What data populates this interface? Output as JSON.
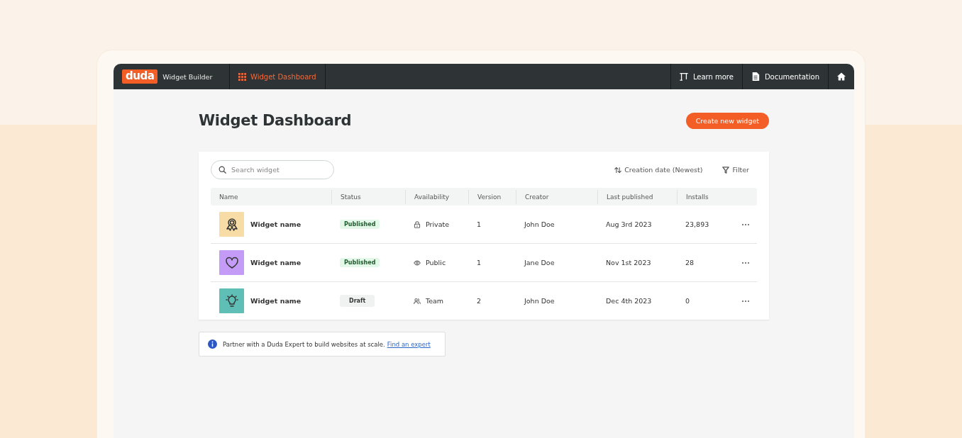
{
  "navbar": {
    "logo": "duda",
    "product": "Widget Builder",
    "tabs": [
      {
        "label": "Widget Dashboard",
        "selected": true
      }
    ],
    "links": [
      {
        "kind": "learn",
        "label": "Learn more"
      },
      {
        "kind": "docs",
        "label": "Documentation"
      },
      {
        "kind": "home"
      }
    ]
  },
  "page": {
    "title": "Widget Dashboard",
    "create_button": "Create new widget"
  },
  "toolbar": {
    "search": {
      "placeholder": "Search widget"
    },
    "sort": "Creation date (Newest)",
    "filter": "Filter"
  },
  "table": {
    "columns": [
      "Name",
      "Status",
      "Availability",
      "Version",
      "Creator",
      "Last published",
      "Installs"
    ],
    "rows": [
      {
        "kind": "badge",
        "color": "#f8dca6",
        "name": "Widget name",
        "status": {
          "kind": "published",
          "label": "Published"
        },
        "availability": {
          "kind": "private",
          "label": "Private"
        },
        "version": "1",
        "creator": "John Doe",
        "last_published": "Aug 3rd 2023",
        "installs": "23,893"
      },
      {
        "kind": "heart",
        "color": "#c49cf8",
        "name": "Widget name",
        "status": {
          "kind": "published",
          "label": "Published"
        },
        "availability": {
          "kind": "public",
          "label": "Public"
        },
        "version": "1",
        "creator": "Jane Doe",
        "last_published": "Nov 1st 2023",
        "installs": "28"
      },
      {
        "kind": "bulb",
        "color": "#5fbfb6",
        "name": "Widget name",
        "status": {
          "kind": "draft",
          "label": "Draft"
        },
        "availability": {
          "kind": "team",
          "label": "Team"
        },
        "version": "2",
        "creator": "John Doe",
        "last_published": "Dec 4th 2023",
        "installs": "0"
      }
    ]
  },
  "notice": {
    "text": "Partner with a Duda Expert to build websites at scale.",
    "link": "Find an expert"
  }
}
